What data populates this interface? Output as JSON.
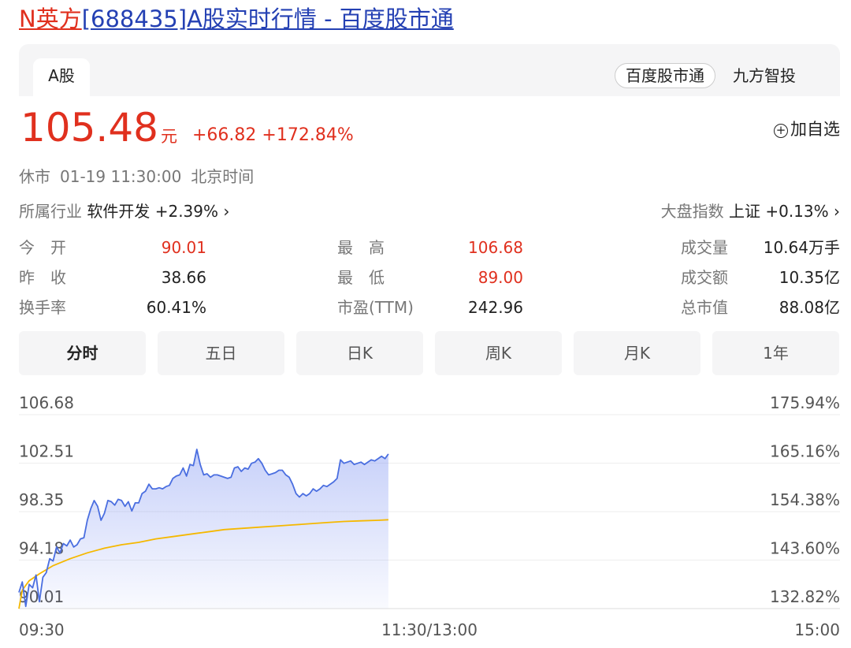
{
  "page": {
    "title_name": "N英方",
    "title_rest": "[688435]A股实时行情 - 百度股市通"
  },
  "tabs": {
    "market": "A股",
    "provider_chip": "百度股市通",
    "provider_2": "九方智投"
  },
  "quote": {
    "price": "105.48",
    "unit": "元",
    "change": "+66.82",
    "change_pct": "+172.84%",
    "add_watch": "加自选",
    "status": "休市",
    "date_time": "01-19 11:30:00",
    "tz": "北京时间"
  },
  "industry": {
    "label": "所属行业",
    "name": "软件开发",
    "change": "+2.39%",
    "arrow": "›"
  },
  "index": {
    "label": "大盘指数",
    "name": "上证",
    "change": "+0.13%",
    "arrow": "›"
  },
  "stats": [
    {
      "l1": "今　开",
      "v1": "90.01",
      "l2": "最　高",
      "v2": "106.68",
      "l3": "成交量",
      "v3": "10.64万手"
    },
    {
      "l1": "昨　收",
      "v1": "38.66",
      "l2": "最　低",
      "v2": "89.00",
      "l3": "成交额",
      "v3": "10.35亿"
    },
    {
      "l1": "换手率",
      "v1": "60.41%",
      "l2": "市盈(TTM)",
      "v2": "242.96",
      "l3": "总市值",
      "v3": "88.08亿"
    }
  ],
  "periods": [
    "分时",
    "五日",
    "日K",
    "周K",
    "月K",
    "1年"
  ],
  "active_period": 0,
  "colors": {
    "up": "#e0301e",
    "price_line": "#4a6ee0",
    "avg_line": "#f5b800",
    "grid": "#eeeeee"
  },
  "chart_data": {
    "type": "line",
    "y_left_ticks": [
      "106.68",
      "102.51",
      "98.35",
      "94.18",
      "90.01"
    ],
    "y_right_ticks": [
      "175.94%",
      "165.16%",
      "154.38%",
      "143.60%",
      "132.82%"
    ],
    "ylim": [
      90.01,
      106.68
    ],
    "x_ticks": [
      "09:30",
      "11:30/13:00",
      "15:00"
    ],
    "x_range_minutes": [
      0,
      240
    ],
    "series": [
      {
        "key": "price",
        "points": [
          [
            0,
            91.4
          ],
          [
            1,
            92.3
          ],
          [
            2,
            90.2
          ],
          [
            3,
            92.1
          ],
          [
            4,
            91.8
          ],
          [
            5,
            92.9
          ],
          [
            6,
            90.6
          ],
          [
            7,
            92.7
          ],
          [
            8,
            93.1
          ],
          [
            9,
            94.3
          ],
          [
            10,
            94.1
          ],
          [
            11,
            95.3
          ],
          [
            12,
            94.8
          ],
          [
            13,
            95.6
          ],
          [
            14,
            95.4
          ],
          [
            15,
            95.9
          ],
          [
            16,
            95.3
          ],
          [
            17,
            95.5
          ],
          [
            18,
            96.0
          ],
          [
            19,
            96.1
          ],
          [
            20,
            97.6
          ],
          [
            21,
            98.6
          ],
          [
            22,
            99.3
          ],
          [
            23,
            98.8
          ],
          [
            24,
            97.6
          ],
          [
            25,
            98.2
          ],
          [
            26,
            99.3
          ],
          [
            27,
            99.2
          ],
          [
            28,
            98.9
          ],
          [
            29,
            99.4
          ],
          [
            30,
            99.3
          ],
          [
            31,
            98.8
          ],
          [
            32,
            99.2
          ],
          [
            33,
            98.4
          ],
          [
            34,
            99.1
          ],
          [
            35,
            99.1
          ],
          [
            36,
            99.9
          ],
          [
            37,
            100.1
          ],
          [
            38,
            100.7
          ],
          [
            39,
            100.3
          ],
          [
            40,
            100.3
          ],
          [
            41,
            100.4
          ],
          [
            42,
            100.3
          ],
          [
            43,
            100.5
          ],
          [
            44,
            100.6
          ],
          [
            45,
            101.2
          ],
          [
            46,
            101.4
          ],
          [
            47,
            101.5
          ],
          [
            48,
            102.1
          ],
          [
            49,
            101.4
          ],
          [
            50,
            102.4
          ],
          [
            51,
            102.3
          ],
          [
            52,
            103.7
          ],
          [
            53,
            102.4
          ],
          [
            54,
            101.5
          ],
          [
            55,
            101.6
          ],
          [
            56,
            101.3
          ],
          [
            57,
            101.5
          ],
          [
            58,
            101.5
          ],
          [
            59,
            101.4
          ],
          [
            60,
            101.3
          ],
          [
            61,
            101.2
          ],
          [
            62,
            101.3
          ],
          [
            63,
            102.1
          ],
          [
            64,
            102.2
          ],
          [
            65,
            101.8
          ],
          [
            66,
            102.1
          ],
          [
            67,
            102.0
          ],
          [
            68,
            102.5
          ],
          [
            69,
            102.6
          ],
          [
            70,
            102.9
          ],
          [
            71,
            102.5
          ],
          [
            72,
            101.9
          ],
          [
            73,
            101.5
          ],
          [
            74,
            101.6
          ],
          [
            75,
            101.7
          ],
          [
            76,
            101.9
          ],
          [
            77,
            101.9
          ],
          [
            78,
            101.5
          ],
          [
            79,
            101.3
          ],
          [
            80,
            100.7
          ],
          [
            81,
            99.9
          ],
          [
            82,
            99.6
          ],
          [
            83,
            99.9
          ],
          [
            84,
            99.7
          ],
          [
            85,
            99.9
          ],
          [
            86,
            100.3
          ],
          [
            87,
            100.1
          ],
          [
            88,
            100.3
          ],
          [
            89,
            100.6
          ],
          [
            90,
            100.5
          ],
          [
            91,
            100.7
          ],
          [
            92,
            100.9
          ],
          [
            93,
            101.2
          ],
          [
            94,
            102.8
          ],
          [
            95,
            102.5
          ],
          [
            96,
            102.6
          ],
          [
            97,
            102.7
          ],
          [
            98,
            102.4
          ],
          [
            99,
            102.5
          ],
          [
            100,
            102.6
          ],
          [
            101,
            102.4
          ],
          [
            102,
            102.6
          ],
          [
            103,
            102.8
          ],
          [
            104,
            102.7
          ],
          [
            105,
            102.9
          ],
          [
            106,
            103.1
          ],
          [
            107,
            102.9
          ],
          [
            108,
            103.3
          ]
        ]
      },
      {
        "key": "avg",
        "points": [
          [
            0,
            90.0
          ],
          [
            1,
            91.6
          ],
          [
            3,
            92.4
          ],
          [
            6,
            93.0
          ],
          [
            10,
            93.7
          ],
          [
            15,
            94.3
          ],
          [
            20,
            94.8
          ],
          [
            25,
            95.2
          ],
          [
            30,
            95.5
          ],
          [
            35,
            95.7
          ],
          [
            40,
            96.0
          ],
          [
            45,
            96.2
          ],
          [
            50,
            96.4
          ],
          [
            55,
            96.6
          ],
          [
            60,
            96.8
          ],
          [
            65,
            96.9
          ],
          [
            70,
            97.0
          ],
          [
            75,
            97.1
          ],
          [
            80,
            97.2
          ],
          [
            85,
            97.3
          ],
          [
            90,
            97.4
          ],
          [
            95,
            97.5
          ],
          [
            100,
            97.55
          ],
          [
            105,
            97.6
          ],
          [
            108,
            97.65
          ]
        ]
      }
    ]
  }
}
